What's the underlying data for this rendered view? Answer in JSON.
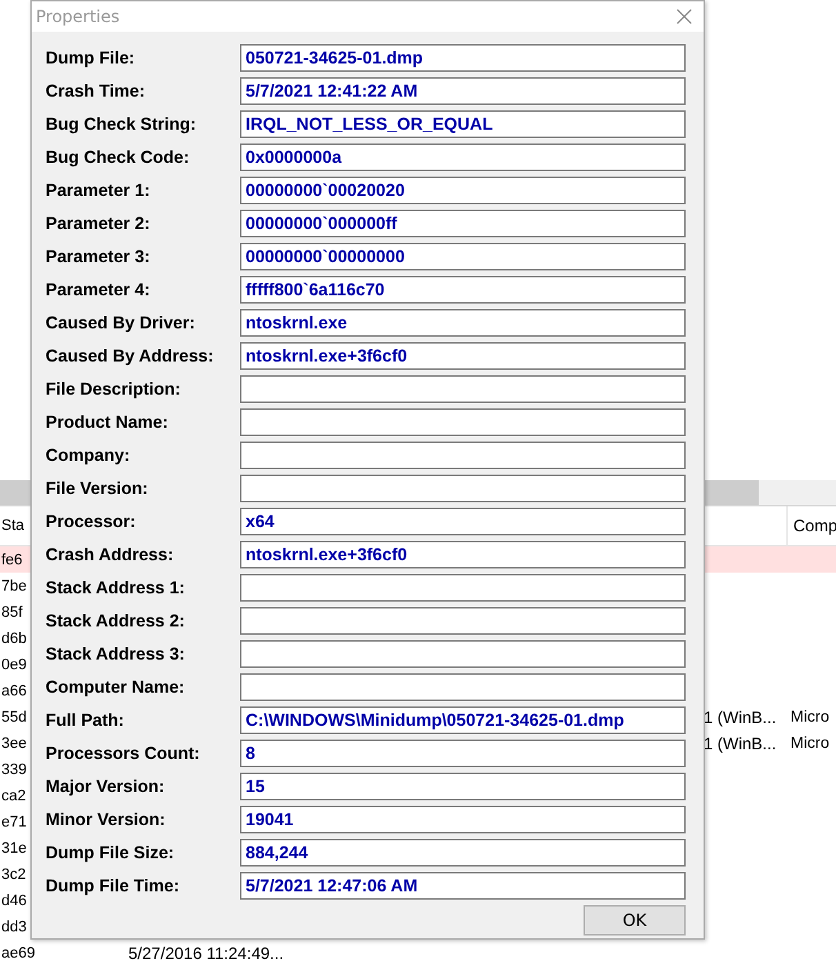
{
  "background_list": {
    "header": {
      "column_1": "Sta",
      "column_4": "Comp"
    },
    "rows": [
      {
        "column_1": "fe6",
        "highlighted": true
      },
      {
        "column_1": "7be",
        "highlighted": false
      },
      {
        "column_1": "85f",
        "highlighted": false
      },
      {
        "column_1": "d6b",
        "highlighted": false
      },
      {
        "column_1": "0e9",
        "highlighted": false
      },
      {
        "column_1": "a66",
        "highlighted": false
      },
      {
        "column_1": "55d",
        "column_3": "1 (WinB...",
        "column_4": "Micro",
        "highlighted": false
      },
      {
        "column_1": "3ee",
        "column_3": "1 (WinB...",
        "column_4": "Micro",
        "highlighted": false
      },
      {
        "column_1": "339",
        "highlighted": false
      },
      {
        "column_1": "ca2",
        "highlighted": false
      },
      {
        "column_1": "e71",
        "highlighted": false
      },
      {
        "column_1": "31e",
        "highlighted": false
      },
      {
        "column_1": "3c2",
        "highlighted": false
      },
      {
        "column_1": "d46",
        "highlighted": false
      },
      {
        "column_1": "dd3",
        "highlighted": false
      },
      {
        "column_1": "ae69",
        "column_2": "5/27/2016 11:24:49...",
        "highlighted": false
      }
    ]
  },
  "dialog": {
    "title": "Properties",
    "fields": [
      {
        "label": "Dump File:",
        "value": "050721-34625-01.dmp"
      },
      {
        "label": "Crash Time:",
        "value": "5/7/2021 12:41:22 AM"
      },
      {
        "label": "Bug Check String:",
        "value": "IRQL_NOT_LESS_OR_EQUAL"
      },
      {
        "label": "Bug Check Code:",
        "value": "0x0000000a"
      },
      {
        "label": "Parameter 1:",
        "value": "00000000`00020020"
      },
      {
        "label": "Parameter 2:",
        "value": "00000000`000000ff"
      },
      {
        "label": "Parameter 3:",
        "value": "00000000`00000000"
      },
      {
        "label": "Parameter 4:",
        "value": "fffff800`6a116c70"
      },
      {
        "label": "Caused By Driver:",
        "value": "ntoskrnl.exe"
      },
      {
        "label": "Caused By Address:",
        "value": "ntoskrnl.exe+3f6cf0"
      },
      {
        "label": "File Description:"
      },
      {
        "label": "Product Name:"
      },
      {
        "label": "Company:"
      },
      {
        "label": "File Version:"
      },
      {
        "label": "Processor:",
        "value": "x64"
      },
      {
        "label": "Crash Address:",
        "value": "ntoskrnl.exe+3f6cf0"
      },
      {
        "label": "Stack Address 1:"
      },
      {
        "label": "Stack Address 2:"
      },
      {
        "label": "Stack Address 3:"
      },
      {
        "label": "Computer Name:"
      },
      {
        "label": "Full Path:",
        "value": "C:\\WINDOWS\\Minidump\\050721-34625-01.dmp"
      },
      {
        "label": "Processors Count:",
        "value": "8"
      },
      {
        "label": "Major Version:",
        "value": "15"
      },
      {
        "label": "Minor Version:",
        "value": "19041"
      },
      {
        "label": "Dump File Size:",
        "value": "884,244"
      },
      {
        "label": "Dump File Time:",
        "value": "5/7/2021 12:47:06 AM"
      }
    ],
    "button": "OK"
  }
}
